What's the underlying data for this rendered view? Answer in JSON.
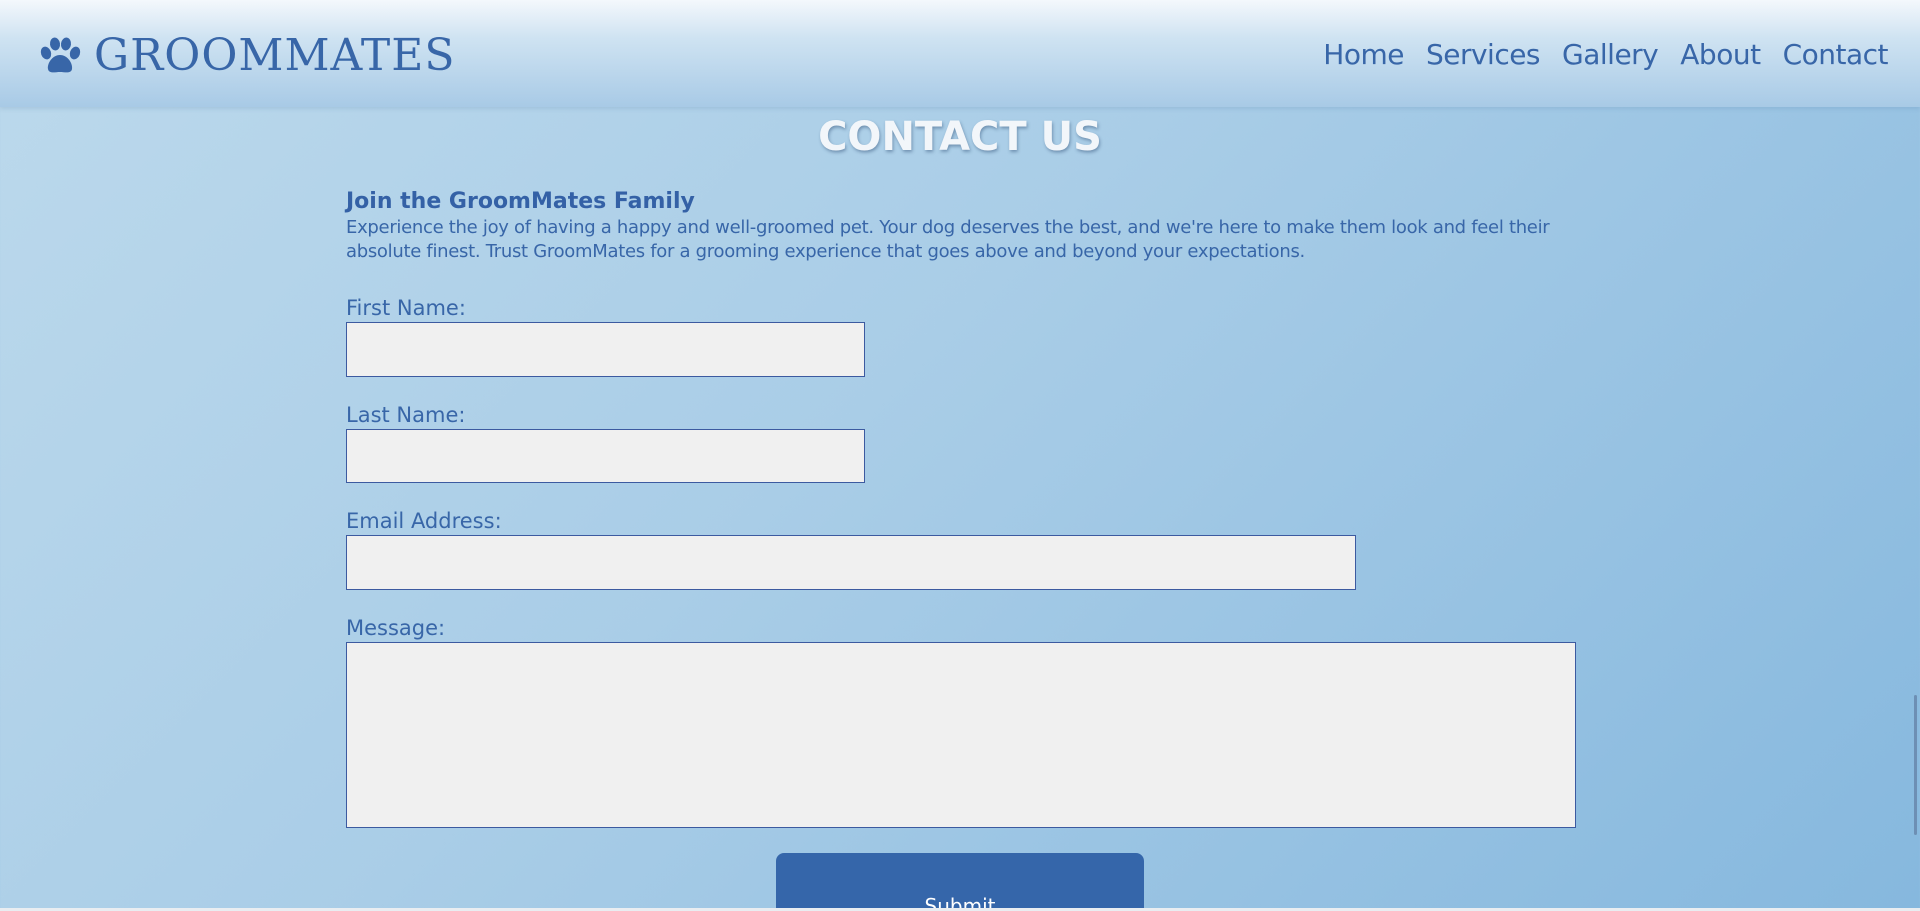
{
  "brand": {
    "name": "GROOMMATES",
    "icon": "paw-icon"
  },
  "nav": [
    {
      "label": "Home"
    },
    {
      "label": "Services"
    },
    {
      "label": "Gallery"
    },
    {
      "label": "About"
    },
    {
      "label": "Contact"
    }
  ],
  "page_title": "CONTACT US",
  "intro": {
    "heading": "Join the GroomMates Family",
    "body": "Experience the joy of having a happy and well-groomed pet. Your dog deserves the best, and we're here to make them look and feel their absolute finest. Trust GroomMates for a grooming experience that goes above and beyond your expectations."
  },
  "form": {
    "first_name": {
      "label": "First Name:",
      "value": ""
    },
    "last_name": {
      "label": "Last Name:",
      "value": ""
    },
    "email": {
      "label": "Email Address:",
      "value": ""
    },
    "message": {
      "label": "Message:",
      "value": ""
    },
    "submit_label": "Submit"
  },
  "colors": {
    "brand_blue": "#3866a8",
    "button_blue": "#3566aa",
    "field_bg": "#f0f0f0"
  }
}
